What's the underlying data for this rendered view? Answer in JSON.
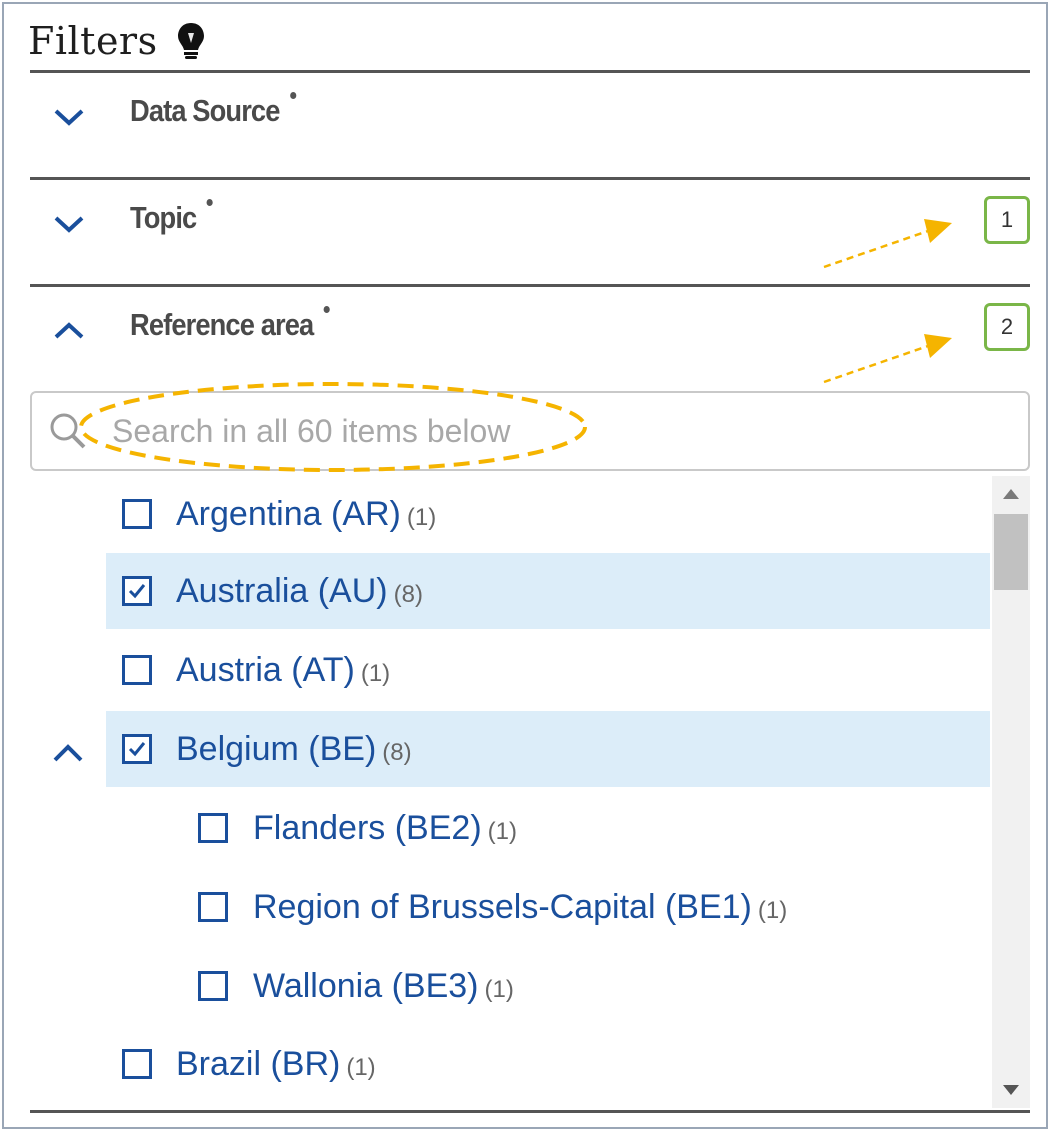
{
  "panel": {
    "title": "Filters",
    "title_icon": "lightbulb-icon"
  },
  "sections": [
    {
      "label": "Data Source",
      "state": "collapsed"
    },
    {
      "label": "Topic",
      "state": "collapsed",
      "badge": "1"
    },
    {
      "label": "Reference area",
      "state": "expanded",
      "badge": "2"
    }
  ],
  "search": {
    "placeholder": "Search in all 60 items below"
  },
  "items": [
    {
      "label": "Argentina (AR)",
      "count": "(1)",
      "checked": false
    },
    {
      "label": "Australia (AU)",
      "count": "(8)",
      "checked": true
    },
    {
      "label": "Austria (AT)",
      "count": "(1)",
      "checked": false
    },
    {
      "label": "Belgium (BE)",
      "count": "(8)",
      "checked": true,
      "expanded": true
    },
    {
      "label": "Flanders (BE2)",
      "count": "(1)",
      "checked": false,
      "child": true
    },
    {
      "label": "Region of Brussels-Capital (BE1)",
      "count": "(1)",
      "checked": false,
      "child": true
    },
    {
      "label": "Wallonia (BE3)",
      "count": "(1)",
      "checked": false,
      "child": true
    },
    {
      "label": "Brazil (BR)",
      "count": "(1)",
      "checked": false
    }
  ],
  "colors": {
    "accent": "#1a4f9c",
    "selected_row": "#dcedf9",
    "badge_border": "#7ab648",
    "annotation": "#f5b400"
  }
}
